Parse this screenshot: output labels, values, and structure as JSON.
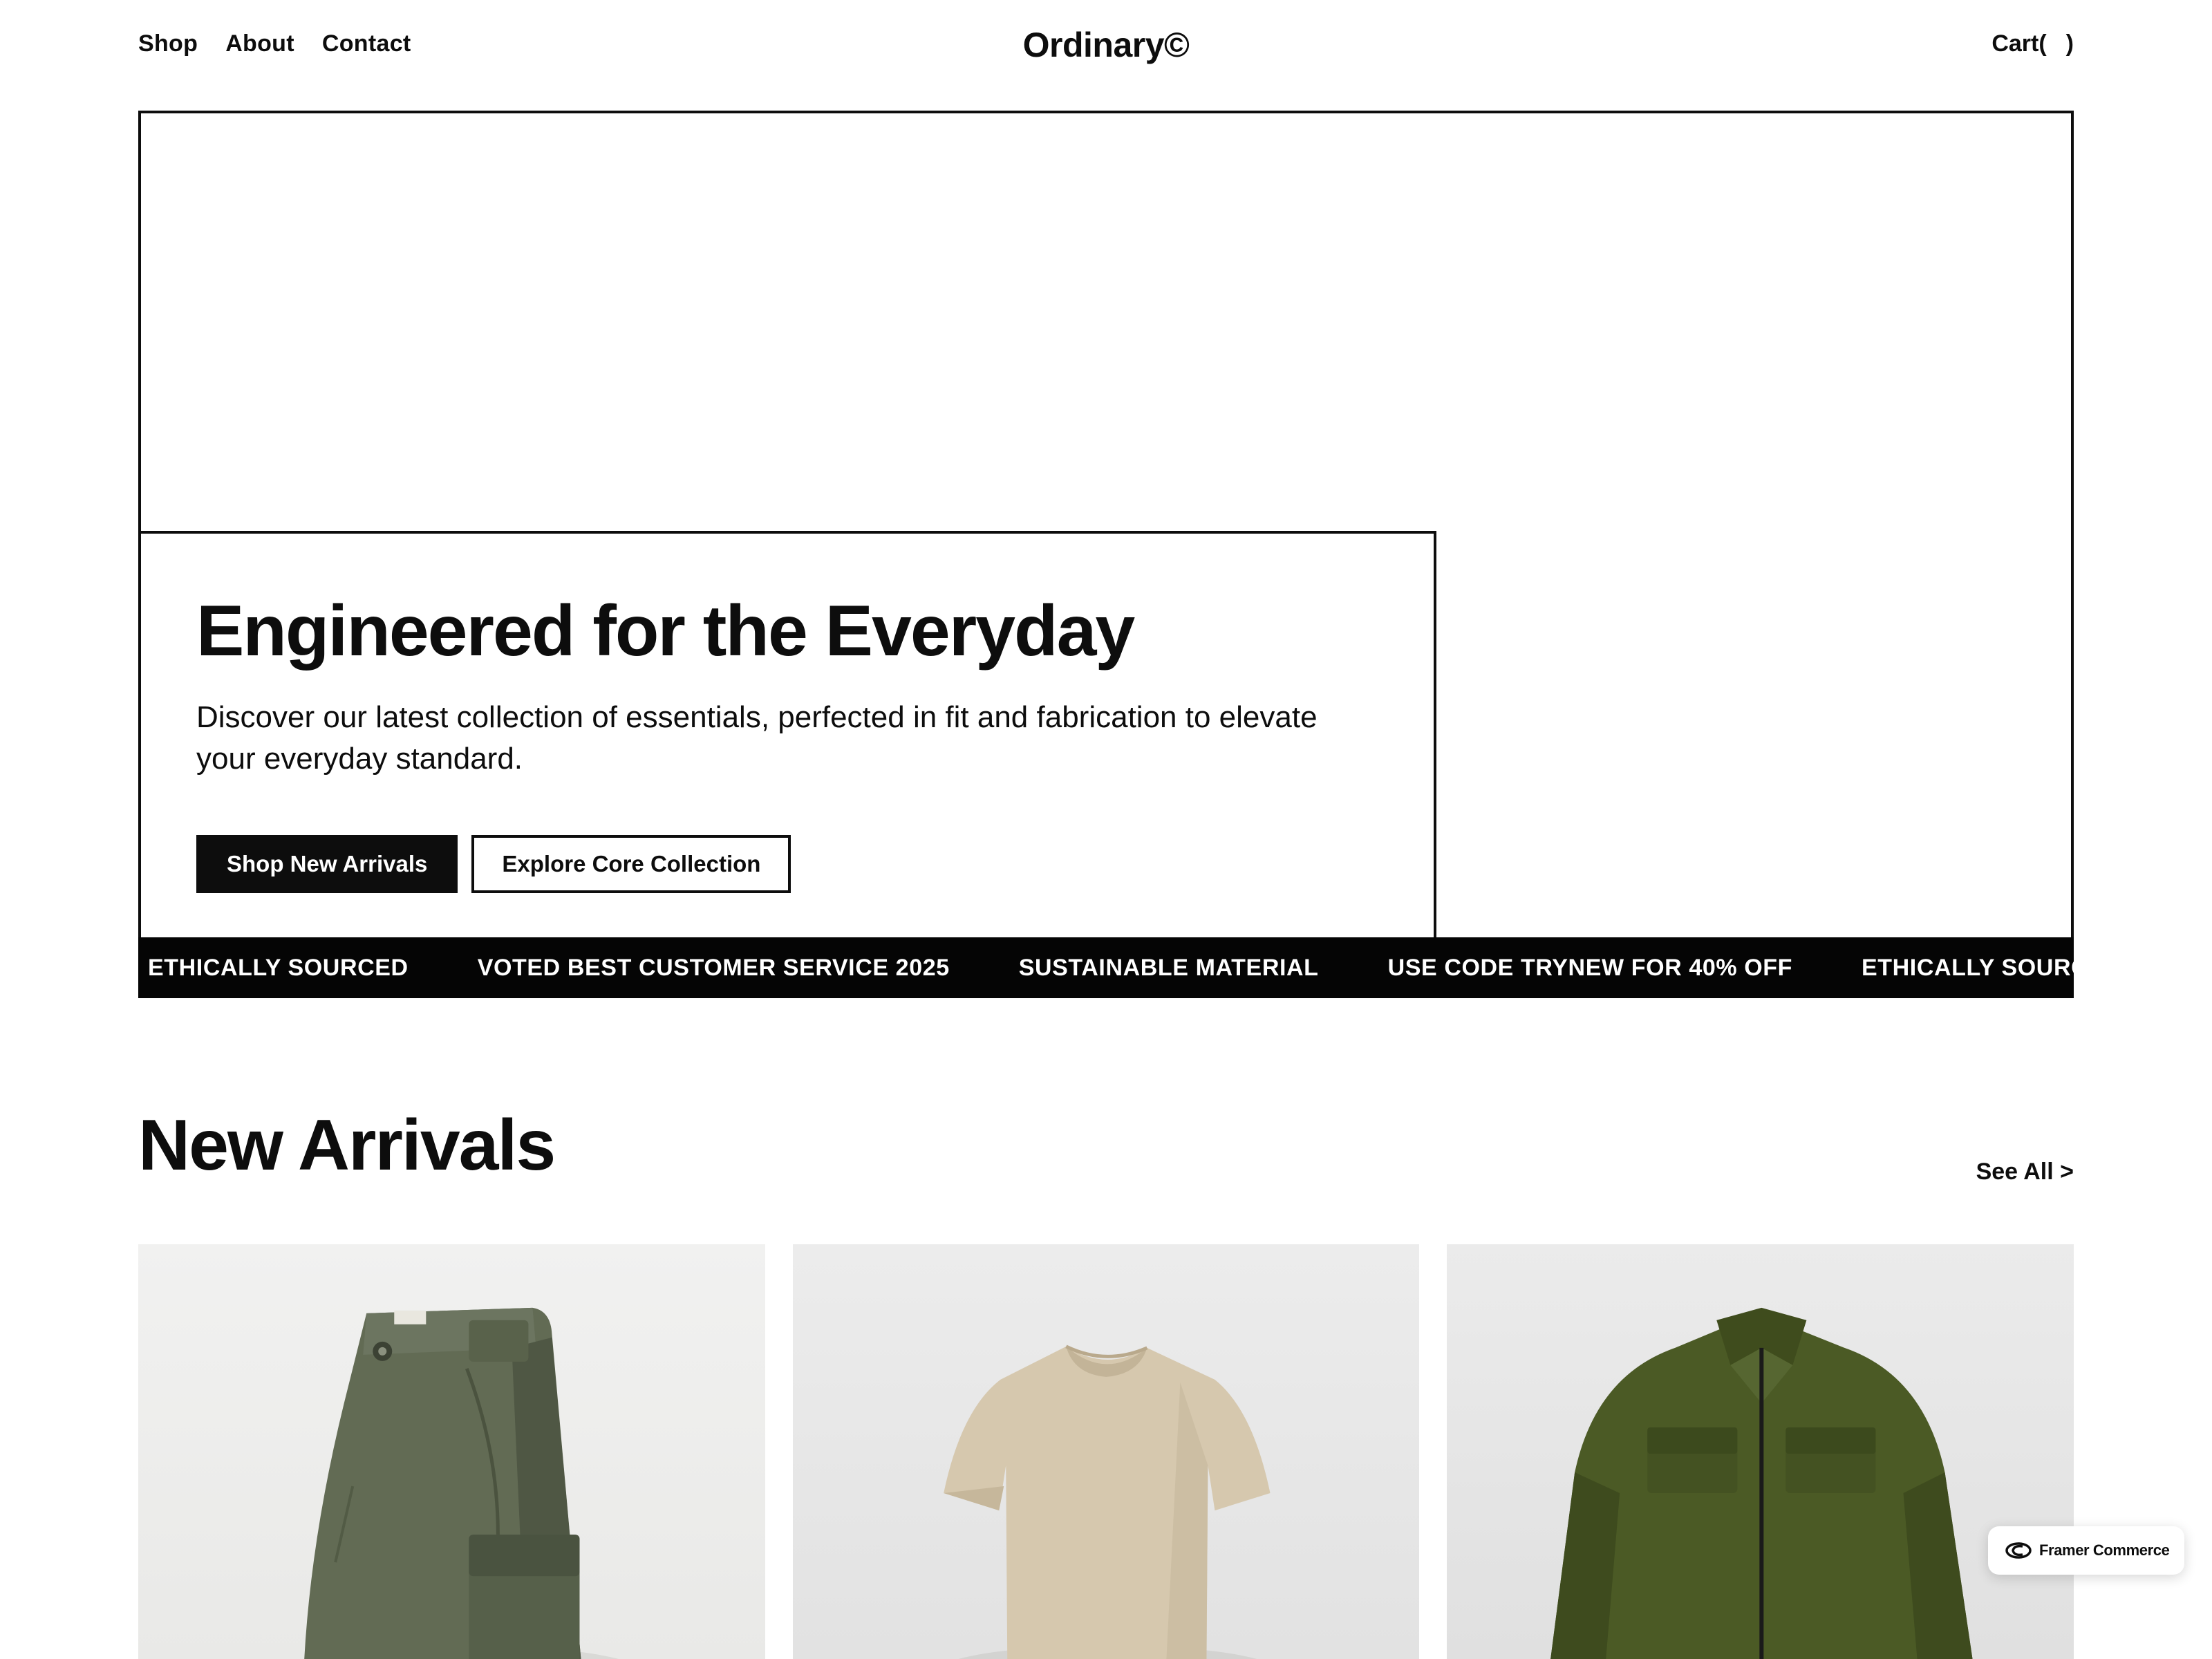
{
  "header": {
    "nav": [
      "Shop",
      "About",
      "Contact"
    ],
    "logo": "Ordinary©",
    "cart": {
      "label": "Cart(",
      "count": "",
      "close": ")"
    }
  },
  "hero": {
    "title": "Engineered for the Everyday",
    "subtitle": "Discover our latest collection of essentials, perfected in fit and fabrication to elevate your everyday standard.",
    "primary_button": "Shop New Arrivals",
    "secondary_button": "Explore Core Collection"
  },
  "ticker": {
    "items": [
      "ETHICALLY SOURCED",
      "VOTED BEST CUSTOMER SERVICE 2025",
      "SUSTAINABLE MATERIAL",
      "USE CODE TRYNEW FOR 40% OFF",
      "ETHICALLY SOURCED"
    ]
  },
  "arrivals": {
    "title": "New Arrivals",
    "see_all": "See All >",
    "products": [
      {
        "image_icon": "cargo-shorts-image",
        "color": "#626b54"
      },
      {
        "image_icon": "tshirt-image",
        "color": "#d6c8ae"
      },
      {
        "image_icon": "jacket-image",
        "color": "#4b5a25"
      }
    ]
  },
  "badge": {
    "label": "Framer Commerce"
  },
  "colors": {
    "text": "#0d0d0d",
    "ticker_bg": "#050505",
    "background": "#ffffff"
  }
}
